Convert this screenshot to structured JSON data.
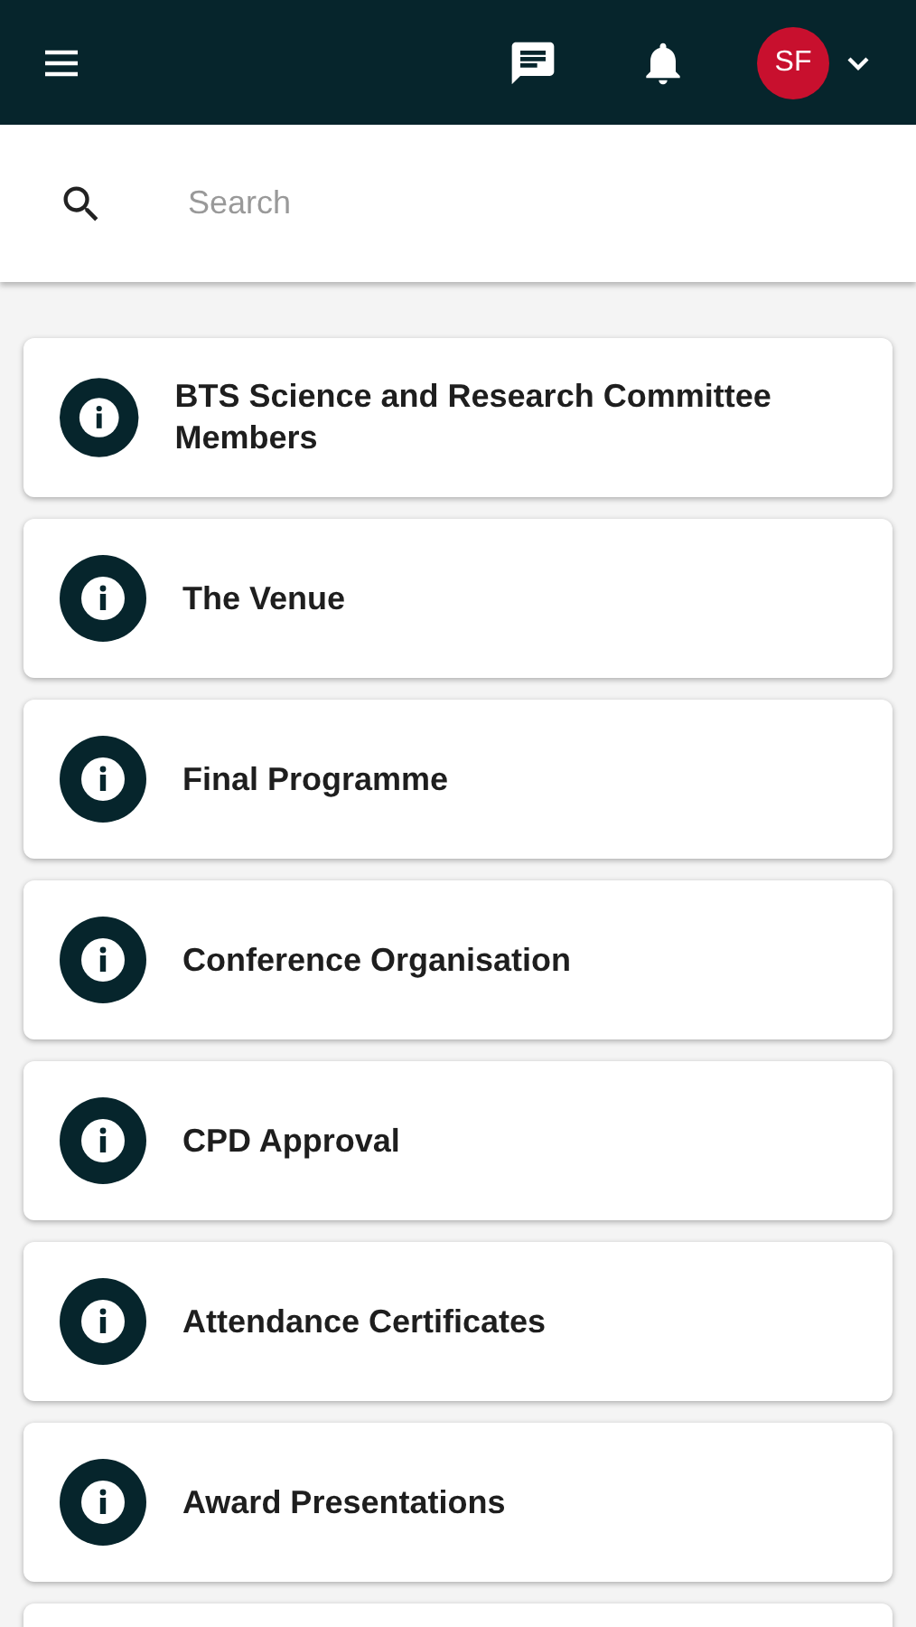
{
  "header": {
    "avatar": {
      "initials": "SF"
    }
  },
  "search": {
    "placeholder": "Search"
  },
  "items": [
    {
      "title": "BTS Science and Research Committee Members"
    },
    {
      "title": "The Venue"
    },
    {
      "title": "Final Programme"
    },
    {
      "title": "Conference Organisation"
    },
    {
      "title": "CPD Approval"
    },
    {
      "title": "Attendance Certificates"
    },
    {
      "title": "Award Presentations"
    }
  ]
}
